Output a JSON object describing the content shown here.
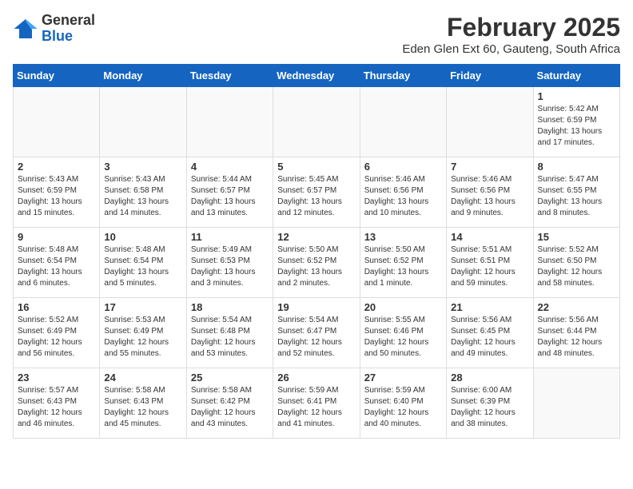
{
  "logo": {
    "general": "General",
    "blue": "Blue"
  },
  "title": "February 2025",
  "subtitle": "Eden Glen Ext 60, Gauteng, South Africa",
  "headers": [
    "Sunday",
    "Monday",
    "Tuesday",
    "Wednesday",
    "Thursday",
    "Friday",
    "Saturday"
  ],
  "weeks": [
    [
      {
        "day": "",
        "info": ""
      },
      {
        "day": "",
        "info": ""
      },
      {
        "day": "",
        "info": ""
      },
      {
        "day": "",
        "info": ""
      },
      {
        "day": "",
        "info": ""
      },
      {
        "day": "",
        "info": ""
      },
      {
        "day": "1",
        "info": "Sunrise: 5:42 AM\nSunset: 6:59 PM\nDaylight: 13 hours and 17 minutes."
      }
    ],
    [
      {
        "day": "2",
        "info": "Sunrise: 5:43 AM\nSunset: 6:59 PM\nDaylight: 13 hours and 15 minutes."
      },
      {
        "day": "3",
        "info": "Sunrise: 5:43 AM\nSunset: 6:58 PM\nDaylight: 13 hours and 14 minutes."
      },
      {
        "day": "4",
        "info": "Sunrise: 5:44 AM\nSunset: 6:57 PM\nDaylight: 13 hours and 13 minutes."
      },
      {
        "day": "5",
        "info": "Sunrise: 5:45 AM\nSunset: 6:57 PM\nDaylight: 13 hours and 12 minutes."
      },
      {
        "day": "6",
        "info": "Sunrise: 5:46 AM\nSunset: 6:56 PM\nDaylight: 13 hours and 10 minutes."
      },
      {
        "day": "7",
        "info": "Sunrise: 5:46 AM\nSunset: 6:56 PM\nDaylight: 13 hours and 9 minutes."
      },
      {
        "day": "8",
        "info": "Sunrise: 5:47 AM\nSunset: 6:55 PM\nDaylight: 13 hours and 8 minutes."
      }
    ],
    [
      {
        "day": "9",
        "info": "Sunrise: 5:48 AM\nSunset: 6:54 PM\nDaylight: 13 hours and 6 minutes."
      },
      {
        "day": "10",
        "info": "Sunrise: 5:48 AM\nSunset: 6:54 PM\nDaylight: 13 hours and 5 minutes."
      },
      {
        "day": "11",
        "info": "Sunrise: 5:49 AM\nSunset: 6:53 PM\nDaylight: 13 hours and 3 minutes."
      },
      {
        "day": "12",
        "info": "Sunrise: 5:50 AM\nSunset: 6:52 PM\nDaylight: 13 hours and 2 minutes."
      },
      {
        "day": "13",
        "info": "Sunrise: 5:50 AM\nSunset: 6:52 PM\nDaylight: 13 hours and 1 minute."
      },
      {
        "day": "14",
        "info": "Sunrise: 5:51 AM\nSunset: 6:51 PM\nDaylight: 12 hours and 59 minutes."
      },
      {
        "day": "15",
        "info": "Sunrise: 5:52 AM\nSunset: 6:50 PM\nDaylight: 12 hours and 58 minutes."
      }
    ],
    [
      {
        "day": "16",
        "info": "Sunrise: 5:52 AM\nSunset: 6:49 PM\nDaylight: 12 hours and 56 minutes."
      },
      {
        "day": "17",
        "info": "Sunrise: 5:53 AM\nSunset: 6:49 PM\nDaylight: 12 hours and 55 minutes."
      },
      {
        "day": "18",
        "info": "Sunrise: 5:54 AM\nSunset: 6:48 PM\nDaylight: 12 hours and 53 minutes."
      },
      {
        "day": "19",
        "info": "Sunrise: 5:54 AM\nSunset: 6:47 PM\nDaylight: 12 hours and 52 minutes."
      },
      {
        "day": "20",
        "info": "Sunrise: 5:55 AM\nSunset: 6:46 PM\nDaylight: 12 hours and 50 minutes."
      },
      {
        "day": "21",
        "info": "Sunrise: 5:56 AM\nSunset: 6:45 PM\nDaylight: 12 hours and 49 minutes."
      },
      {
        "day": "22",
        "info": "Sunrise: 5:56 AM\nSunset: 6:44 PM\nDaylight: 12 hours and 48 minutes."
      }
    ],
    [
      {
        "day": "23",
        "info": "Sunrise: 5:57 AM\nSunset: 6:43 PM\nDaylight: 12 hours and 46 minutes."
      },
      {
        "day": "24",
        "info": "Sunrise: 5:58 AM\nSunset: 6:43 PM\nDaylight: 12 hours and 45 minutes."
      },
      {
        "day": "25",
        "info": "Sunrise: 5:58 AM\nSunset: 6:42 PM\nDaylight: 12 hours and 43 minutes."
      },
      {
        "day": "26",
        "info": "Sunrise: 5:59 AM\nSunset: 6:41 PM\nDaylight: 12 hours and 41 minutes."
      },
      {
        "day": "27",
        "info": "Sunrise: 5:59 AM\nSunset: 6:40 PM\nDaylight: 12 hours and 40 minutes."
      },
      {
        "day": "28",
        "info": "Sunrise: 6:00 AM\nSunset: 6:39 PM\nDaylight: 12 hours and 38 minutes."
      },
      {
        "day": "",
        "info": ""
      }
    ]
  ]
}
